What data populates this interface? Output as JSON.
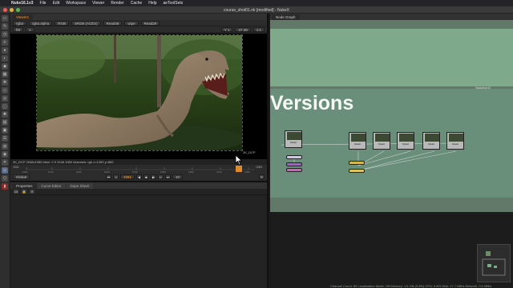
{
  "menubar": {
    "app_name": "Nuke16.1v3",
    "items": [
      "File",
      "Edit",
      "Workspace",
      "Viewer",
      "Render",
      "Cache",
      "Help",
      "aeToolSets"
    ]
  },
  "window": {
    "title": "course_shot01.nk [modified] - NukeX"
  },
  "viewer": {
    "tab_label": "Viewer1",
    "channels": "rgba",
    "alpha": "rgba.alpha",
    "colorspace_a": "RGB",
    "colorspace_b": "sRGB (ACES)",
    "input_a": "Read46",
    "wipe": "wipe",
    "input_b": "Read29",
    "fps": "f/8",
    "gain": "1",
    "zoom": "1:1",
    "gamma": "Y 1",
    "frame_value": "37.39",
    "format_label": "2K_DCP",
    "info_line": "2K_DCP 2048x1080  bbox: 0 0 2048 1080 channels: rgb    x=1263 y=882",
    "timeline_start": "1001",
    "timeline_ticks": [
      "1001",
      "1010",
      "1020",
      "1030",
      "1040",
      "1050",
      "1060",
      "1070",
      "1080"
    ],
    "timeline_end": "1083",
    "playback_mode": "Global",
    "current_frame": "1061",
    "increment": "10"
  },
  "properties": {
    "tabs": [
      "Properties",
      "Curve Editor",
      "Dope Sheet"
    ],
    "max_panels": "10"
  },
  "nodegraph": {
    "tab_label": "Node Graph",
    "backdrop_title": "Versions",
    "backdrop_tag": "Backdrop14",
    "status": "Channel Count: 89  Localization Mode: Off  Memory: 1.6 GB (9.8%)  CPU: 6.8%  Disk: 17.7 MB/s  Network: 0.0 MB/s"
  },
  "colors": {
    "accent": "#ff9a2a",
    "backdrop_main": "#698e79",
    "backdrop_top": "#7ea98a"
  }
}
